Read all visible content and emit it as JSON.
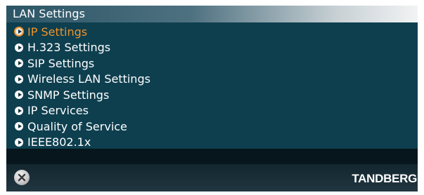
{
  "window": {
    "title": "LAN Settings"
  },
  "menu": {
    "items": [
      {
        "label": "IP Settings",
        "selected": true
      },
      {
        "label": "H.323 Settings",
        "selected": false
      },
      {
        "label": "SIP Settings",
        "selected": false
      },
      {
        "label": "Wireless LAN Settings",
        "selected": false
      },
      {
        "label": "SNMP Settings",
        "selected": false
      },
      {
        "label": "IP Services",
        "selected": false
      },
      {
        "label": "Quality of Service",
        "selected": false
      },
      {
        "label": "IEEE802.1x",
        "selected": false
      }
    ]
  },
  "footer": {
    "close_icon": "close-icon",
    "brand": "TANDBERG"
  },
  "colors": {
    "panel": "#0e3f4f",
    "selected_text": "#f0932b",
    "text": "#ffffff"
  }
}
